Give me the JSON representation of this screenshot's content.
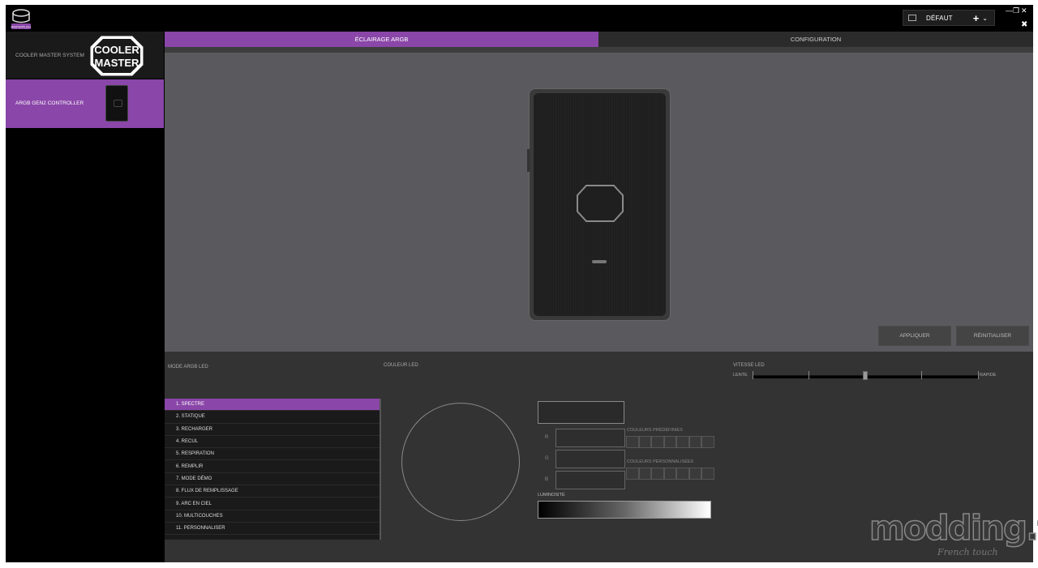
{
  "app": {
    "logo_text": "MASTERPLUS+"
  },
  "profile": {
    "name": "DÉFAUT",
    "add": "+",
    "expand": "⌄"
  },
  "window": {
    "minimize": "—",
    "restore": "❐",
    "close": "✕",
    "close2": "✖"
  },
  "sidebar": {
    "system_label": "COOLER MASTER SYSTEM",
    "brand_logo": "COOLER MASTER",
    "device_label": "ARGB GEN2 CONTROLLER"
  },
  "tabs": {
    "lighting": "ÉCLAIRAGE ARGB",
    "configuration": "CONFIGURATION"
  },
  "buttons": {
    "apply": "APPLIQUER",
    "reset": "RÉINITIALISER"
  },
  "controls": {
    "mode_label": "MODE ARGB LED",
    "color_label": "COULEUR LED",
    "speed_label": "VITESSE LED",
    "speed_slow": "LENTE",
    "speed_fast": "RAPIDE",
    "speed_level": 3,
    "speed_levels": 5,
    "modes": [
      "1. SPECTRE",
      "2. STATIQUE",
      "3. RECHARGER",
      "4. RECUL",
      "5. RESPIRATION",
      "6. REMPLIR",
      "7. MODE DÉMO",
      "8. FLUX DE REMPLISSAGE",
      "9. ARC EN CIEL",
      "10. MULTICOUCHES",
      "11. PERSONNALISER"
    ],
    "selected_mode": 0,
    "r_label": "R",
    "g_label": "G",
    "b_label": "B",
    "preset_label": "COULEURS PRÉDÉFINIES",
    "custom_label": "COULEURS PERSONNALISÉES",
    "brightness_label": "LUMINOSITÉ"
  },
  "watermark": {
    "text": "modding.fr",
    "tagline": "French touch"
  },
  "colors": {
    "accent": "#8a46a8",
    "panel": "#333333",
    "preview": "#5a5a5e"
  }
}
